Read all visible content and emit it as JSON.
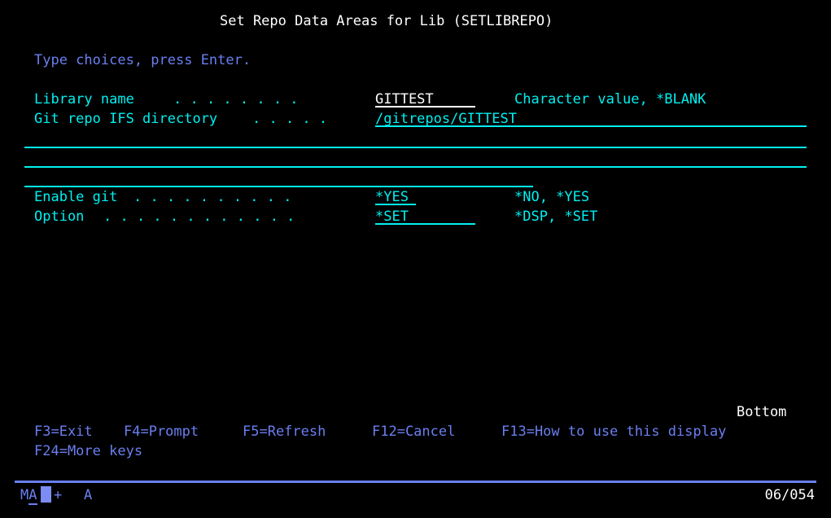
{
  "screen": {
    "columns": 80,
    "rows": 26,
    "background": "#000000",
    "colors": {
      "white": "#ffffff",
      "cyan": "#00f0f0",
      "blue": "#6a7ff0",
      "cursor": "#7b8cf5"
    }
  },
  "header": {
    "title": "Set Repo Data Areas for Lib (SETLIBREPO)",
    "instruction": "Type choices, press Enter."
  },
  "parameters": [
    {
      "label": "Library name",
      "leader": ". . . . . . . .",
      "value": "GITTEST",
      "field_width": 10,
      "value_color": "white",
      "choices": "Character value, *BLANK"
    },
    {
      "label": "Git repo IFS directory",
      "leader": ". . . . .",
      "value": "/gitrepos/GITTEST",
      "field_width": 43,
      "value_color": "cyan",
      "choices": ""
    },
    {
      "label": "Enable git",
      "leader": ". . . . . . . . . .",
      "value": "*YES",
      "field_width": 4,
      "value_color": "cyan",
      "choices": "*NO, *YES"
    },
    {
      "label": "Option",
      "leader": ". . . . . . . . . . . .",
      "value": "*SET",
      "field_width": 10,
      "value_color": "cyan",
      "choices": "*DSP, *SET"
    }
  ],
  "continuation_rules": [
    {
      "width_chars": 79
    },
    {
      "width_chars": 79
    },
    {
      "width_chars": 49
    }
  ],
  "page_indicator": "Bottom",
  "function_keys": {
    "line1": [
      "F3=Exit",
      "F4=Prompt",
      "F5=Refresh",
      "F12=Cancel",
      "F13=How to use this display"
    ],
    "line2": [
      "F24=More keys"
    ]
  },
  "status_bar": {
    "system_indicator": "MA",
    "insert_indicator": "+",
    "keyboard_indicator": "A",
    "cursor_position": "06/054"
  }
}
